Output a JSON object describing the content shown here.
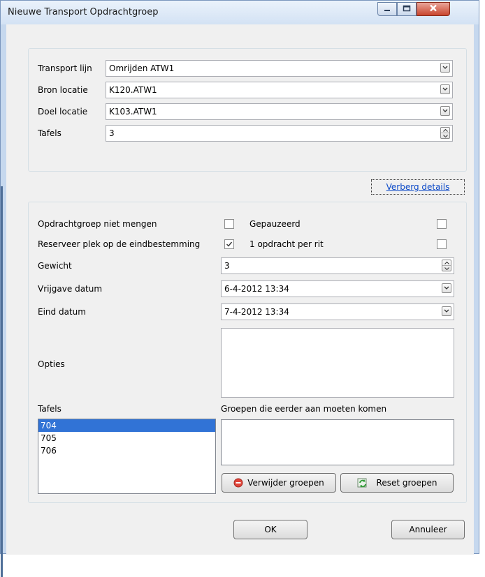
{
  "window": {
    "title": "Nieuwe Transport Opdrachtgroep"
  },
  "top_group": {
    "transport_lijn": {
      "label": "Transport lijn",
      "value": "Omrijden ATW1"
    },
    "bron_locatie": {
      "label": "Bron locatie",
      "value": "K120.ATW1"
    },
    "doel_locatie": {
      "label": "Doel locatie",
      "value": "K103.ATW1"
    },
    "tafels": {
      "label": "Tafels",
      "value": "3"
    }
  },
  "details_link": "Verberg details",
  "details": {
    "niet_mengen": {
      "label": "Opdrachtgroep niet mengen",
      "checked": false
    },
    "gepauzeerd": {
      "label": "Gepauzeerd",
      "checked": false
    },
    "reserveer": {
      "label": "Reserveer plek op de eindbestemming",
      "checked": true
    },
    "een_opdracht": {
      "label": "1 opdracht per rit",
      "checked": false
    },
    "gewicht": {
      "label": "Gewicht",
      "value": "3"
    },
    "vrijgave_datum": {
      "label": "Vrijgave datum",
      "value": "6-4-2012 13:34"
    },
    "eind_datum": {
      "label": "Eind datum",
      "value": "7-4-2012 13:34"
    },
    "opties": {
      "label": "Opties",
      "value": ""
    },
    "tafels_label": "Tafels",
    "tafels_items": [
      "704",
      "705",
      "706"
    ],
    "tafels_selected": 0,
    "groepen_label": "Groepen die eerder aan moeten komen",
    "verwijder_button": "Verwijder groepen",
    "reset_button": "Reset groepen"
  },
  "footer": {
    "ok": "OK",
    "annuleer": "Annuleer"
  },
  "colors": {
    "selection": "#3173d6",
    "link": "#0b49c8",
    "close_button": "#c9452d"
  },
  "icons": {
    "minimize": "minimize-icon",
    "maximize": "maximize-icon",
    "close": "close-icon",
    "dropdown": "chevron-down-icon",
    "spinner": "spinner-arrows-icon",
    "remove": "remove-icon",
    "reset": "refresh-icon"
  }
}
